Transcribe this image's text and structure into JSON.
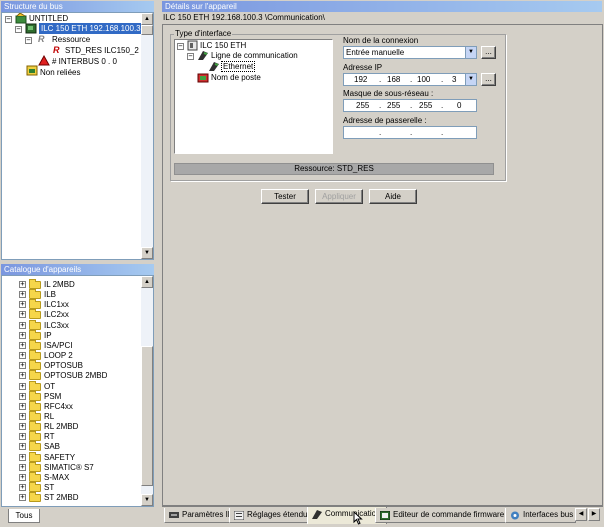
{
  "bus_panel": {
    "title": "Structure du bus",
    "tree": {
      "project": "UNTITLED",
      "controller": "ILC 150 ETH 192.168.100.3",
      "resource_folder": "Ressource",
      "resource": "STD_RES ILC150_2",
      "interbus": "# INTERBUS 0 . 0",
      "unlinked": "Non reliées"
    }
  },
  "catalog_panel": {
    "title": "Catalogue d'appareils",
    "items": [
      "IL 2MBD",
      "ILB",
      "ILC1xx",
      "ILC2xx",
      "ILC3xx",
      "IP",
      "ISA/PCI",
      "LOOP 2",
      "OPTOSUB",
      "OPTOSUB 2MBD",
      "OT",
      "PSM",
      "RFC4xx",
      "RL",
      "RL 2MBD",
      "RT",
      "SAB",
      "SAFETY",
      "SIMATIC® S7",
      "S-MAX",
      "ST",
      "ST 2MBD"
    ],
    "tab_label": "Tous"
  },
  "details_panel": {
    "title": "Détails sur l'appareil",
    "path": "ILC 150 ETH 192.168.100.3 \\Communication\\",
    "group_title": "Type d'interface",
    "iface_tree": {
      "device": "ILC 150 ETH",
      "comm_line": "Ligne de communication",
      "ethernet": "Ethernet",
      "station_name": "Nom de poste"
    },
    "connection_name_label": "Nom de la connexion",
    "connection_name_value": "Entrée manuelle",
    "ip_label": "Adresse IP",
    "ip": [
      "192",
      "168",
      "100",
      "3"
    ],
    "mask_label": "Masque de sous-réseau :",
    "mask": [
      "255",
      "255",
      "255",
      "0"
    ],
    "gateway_label": "Adresse de passerelle :",
    "gateway": [
      "",
      "",
      "",
      ""
    ],
    "ellipsis": "...",
    "resource_status": "Ressource: STD_RES",
    "buttons": {
      "test": "Tester",
      "apply": "Appliquer",
      "help": "Aide"
    }
  },
  "bottom_tabs": [
    "Paramètres IP",
    "Réglages étendus",
    "Communication",
    "Editeur de commande firmware CPU",
    "Interfaces bus"
  ],
  "scroll_glyphs": {
    "up": "▲",
    "down": "▼",
    "left": "◀",
    "right": "▶",
    "combo": "▼"
  },
  "tree_glyphs": {
    "expand": "+",
    "collapse": "−"
  },
  "icons": {
    "project": "project-icon",
    "plc": "plc-icon",
    "resource-folder": "resource-folder-icon",
    "resource": "resource-icon",
    "interbus": "interbus-icon",
    "unlinked": "unlinked-icon",
    "folder": "folder-icon",
    "ethernet": "ethernet-icon",
    "station": "station-icon"
  },
  "colors": {
    "titlebar": "#7a96df",
    "status_bar": "#a8a8a8",
    "face": "#d4d0c8",
    "field_border": "#7f9db9"
  }
}
